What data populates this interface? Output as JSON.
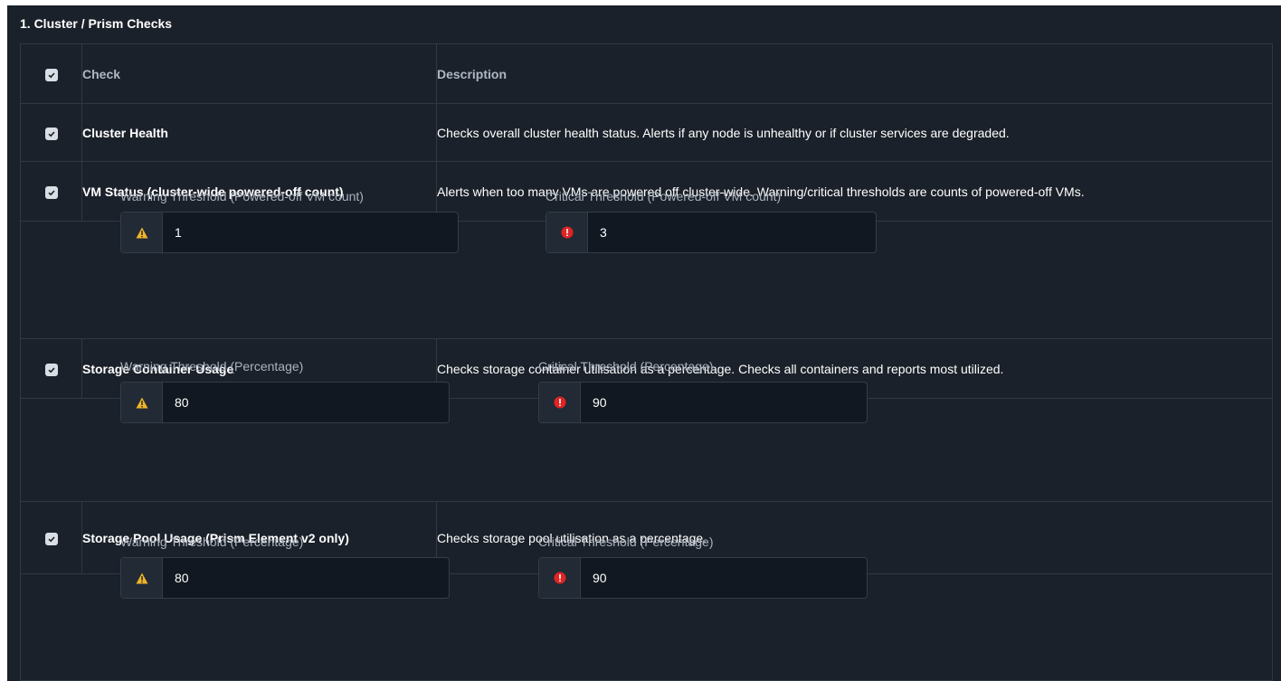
{
  "section": {
    "title": "1. Cluster / Prism Checks"
  },
  "table": {
    "header": {
      "check": "Check",
      "description": "Description"
    },
    "rows": [
      {
        "name": "Cluster Health",
        "description": "Checks overall cluster health status. Alerts if any node is unhealthy or if cluster services are degraded."
      },
      {
        "name": "VM Status (cluster-wide powered-off count)",
        "description": "Alerts when too many VMs are powered off cluster-wide. Warning/critical thresholds are counts of powered-off VMs.",
        "warning_label": "Warning Threshold (Powered-off VM count)",
        "warning_value": "1",
        "critical_label": "Critical Threshold (Powered-off VM count)",
        "critical_value": "3"
      },
      {
        "name": "Storage Container Usage",
        "description": "Checks storage container utilisation as a percentage. Checks all containers and reports most utilized.",
        "warning_label": "Warning Threshold (Percentage)",
        "warning_value": "80",
        "critical_label": "Critical Threshold (Percentage)",
        "critical_value": "90"
      },
      {
        "name": "Storage Pool Usage (Prism Element v2 only)",
        "description": "Checks storage pool utilisation as a percentage.",
        "warning_label": "Warning Threshold (Percentage)",
        "warning_value": "80",
        "critical_label": "Critical Threshold (Percentage)",
        "critical_value": "90"
      }
    ]
  },
  "icons": {
    "warning": "warning-triangle-icon",
    "critical": "critical-exclamation-icon"
  },
  "colors": {
    "warning": "#f0b429",
    "critical": "#e02424",
    "background": "#1b212a"
  }
}
